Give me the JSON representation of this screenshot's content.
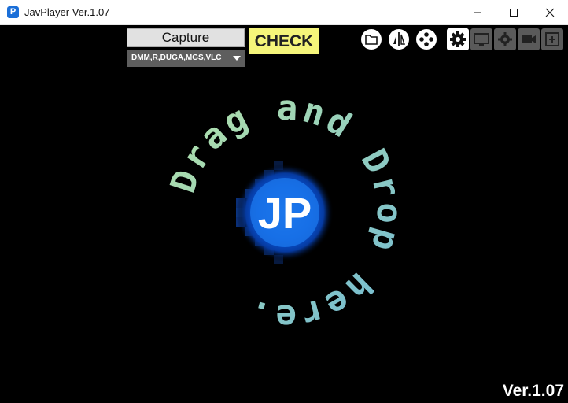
{
  "window": {
    "app_icon_letter": "P",
    "title": "JavPlayer Ver.1.07",
    "minimize_glyph": "minimize",
    "maximize_glyph": "maximize",
    "close_glyph": "close"
  },
  "toolbar": {
    "capture_label": "Capture",
    "site_select_value": "DMM,R,DUGA,MGS,VLC",
    "check_label": "CHECK",
    "icons": [
      "folder-icon",
      "split-view-icon",
      "gamepad-icon",
      "gear-icon",
      "monitor-icon",
      "display-settings-icon",
      "video-camera-icon",
      "add-window-icon"
    ]
  },
  "drop_area": {
    "ring_text": "Drag and Drop here.",
    "logo_letter": "JP"
  },
  "footer": {
    "version": "Ver.1.07"
  },
  "colors": {
    "background": "#000000",
    "check_button": "#f5f57a",
    "logo_blue": "#1a73e8",
    "text_gradient_start": "#b7e4a6",
    "text_gradient_end": "#6fb8d6"
  }
}
